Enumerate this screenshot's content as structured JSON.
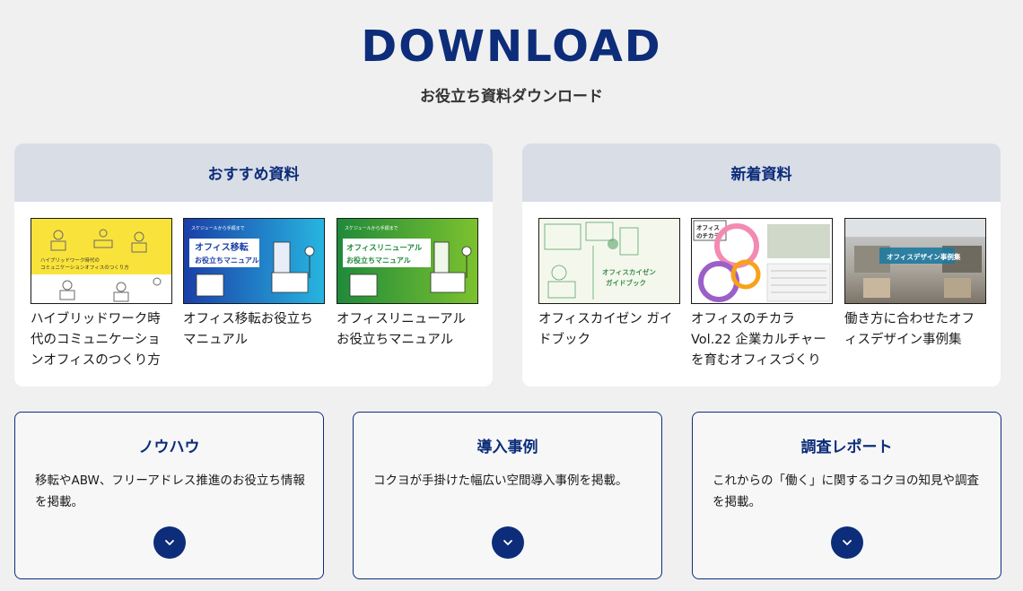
{
  "header": {
    "title": "DOWNLOAD",
    "subtitle": "お役立ち資料ダウンロード"
  },
  "recommended": {
    "heading": "おすすめ資料",
    "items": [
      {
        "title": "ハイブリッドワーク時代のコミュニケーションオフィスのつくり方",
        "thumb_text": "ハイブリッドワーク時代の\nコミュニケーションオフィスのつくり方"
      },
      {
        "title": "オフィス移転お役立ちマニュアル",
        "thumb_text": "オフィス移転\nお役立ちマニュアル"
      },
      {
        "title": "オフィスリニューアルお役立ちマニュアル",
        "thumb_text": "オフィスリニューアル\nお役立ちマニュアル"
      }
    ]
  },
  "new_arrivals": {
    "heading": "新着資料",
    "items": [
      {
        "title": "オフィスカイゼン ガイドブック",
        "thumb_text": "オフィスカイゼン\nガイドブック"
      },
      {
        "title": "オフィスのチカラVol.22 企業カルチャーを育むオフィスづくり",
        "thumb_text": "オフィスのチカラ"
      },
      {
        "title": "働き方に合わせたオフィスデザイン事例集",
        "thumb_text": "オフィスデザイン事例集"
      }
    ]
  },
  "categories": [
    {
      "title": "ノウハウ",
      "desc": "移転やABW、フリーアドレス推進のお役立ち情報を掲載。"
    },
    {
      "title": "導入事例",
      "desc": "コクヨが手掛けた幅広い空間導入事例を掲載。"
    },
    {
      "title": "調査レポート",
      "desc": "これからの「働く」に関するコクヨの知見や調査を掲載。"
    }
  ],
  "colors": {
    "brand": "#0d2d7a",
    "panel_head": "#d8dde6",
    "background": "#f0f0f0"
  }
}
